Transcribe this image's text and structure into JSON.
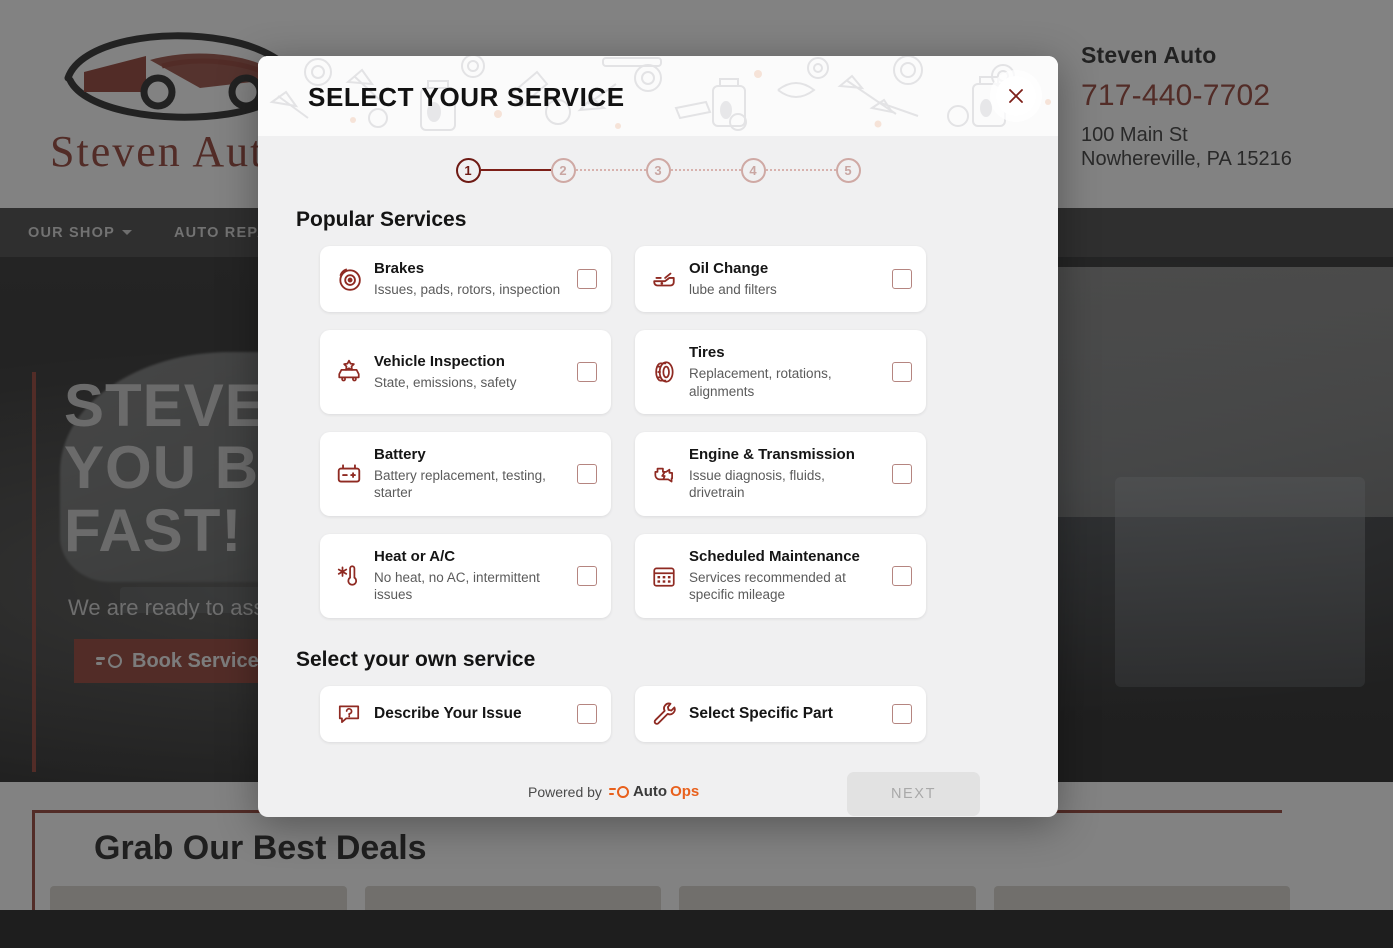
{
  "background": {
    "logo_text": "Steven Auto",
    "business": {
      "name": "Steven Auto",
      "phone": "717-440-7702",
      "address_line1": "100 Main St",
      "address_line2": "Nowhereville, PA 15216"
    },
    "nav": [
      {
        "label": "OUR SHOP",
        "has_caret": true
      },
      {
        "label": "AUTO REPAIR",
        "has_caret": false
      }
    ],
    "hero": {
      "title_line1": "STEVEN",
      "title_line2": "YOU BA",
      "title_line3": "FAST!",
      "subtitle": "We are ready to assis",
      "button_label": "Book Service"
    },
    "deals": {
      "title": "Grab Our Best Deals"
    }
  },
  "modal": {
    "title": "SELECT YOUR SERVICE",
    "close_label": "Close",
    "stepper": {
      "steps": [
        "1",
        "2",
        "3",
        "4",
        "5"
      ],
      "active_index": 0
    },
    "popular_section_title": "Popular Services",
    "own_section_title": "Select your own service",
    "popular_services": [
      {
        "title": "Brakes",
        "desc": "Issues, pads, rotors, inspection",
        "icon": "brake-disc-icon",
        "checked": false
      },
      {
        "title": "Oil Change",
        "desc": "lube and filters",
        "icon": "oil-can-icon",
        "checked": false
      },
      {
        "title": "Vehicle Inspection",
        "desc": "State, emissions, safety",
        "icon": "car-inspection-icon",
        "checked": false
      },
      {
        "title": "Tires",
        "desc": "Replacement, rotations, alignments",
        "icon": "tire-icon",
        "checked": false
      },
      {
        "title": "Battery",
        "desc": "Battery replacement, testing, starter",
        "icon": "battery-icon",
        "checked": false
      },
      {
        "title": "Engine & Transmission",
        "desc": "Issue diagnosis, fluids, drivetrain",
        "icon": "engine-icon",
        "checked": false
      },
      {
        "title": "Heat or A/C",
        "desc": "No heat, no AC, intermittent issues",
        "icon": "thermometer-snowflake-icon",
        "checked": false
      },
      {
        "title": "Scheduled Maintenance",
        "desc": "Services recommended at specific mileage",
        "icon": "calendar-icon",
        "checked": false
      }
    ],
    "own_services": [
      {
        "title": "Describe Your Issue",
        "icon": "question-chat-icon",
        "checked": false
      },
      {
        "title": "Select Specific Part",
        "icon": "wrench-icon",
        "checked": false
      }
    ],
    "next_button_label": "NEXT",
    "powered_by": {
      "prefix": "Powered by",
      "brand_part1": "Auto",
      "brand_part2": "Ops"
    }
  },
  "colors": {
    "brand_red": "#8c3326",
    "deep_red": "#6e1a14",
    "icon_red": "#8f2a22",
    "accent_orange": "#e8601c",
    "modal_bg": "#f0f0f1",
    "card_bg": "#ffffff"
  }
}
